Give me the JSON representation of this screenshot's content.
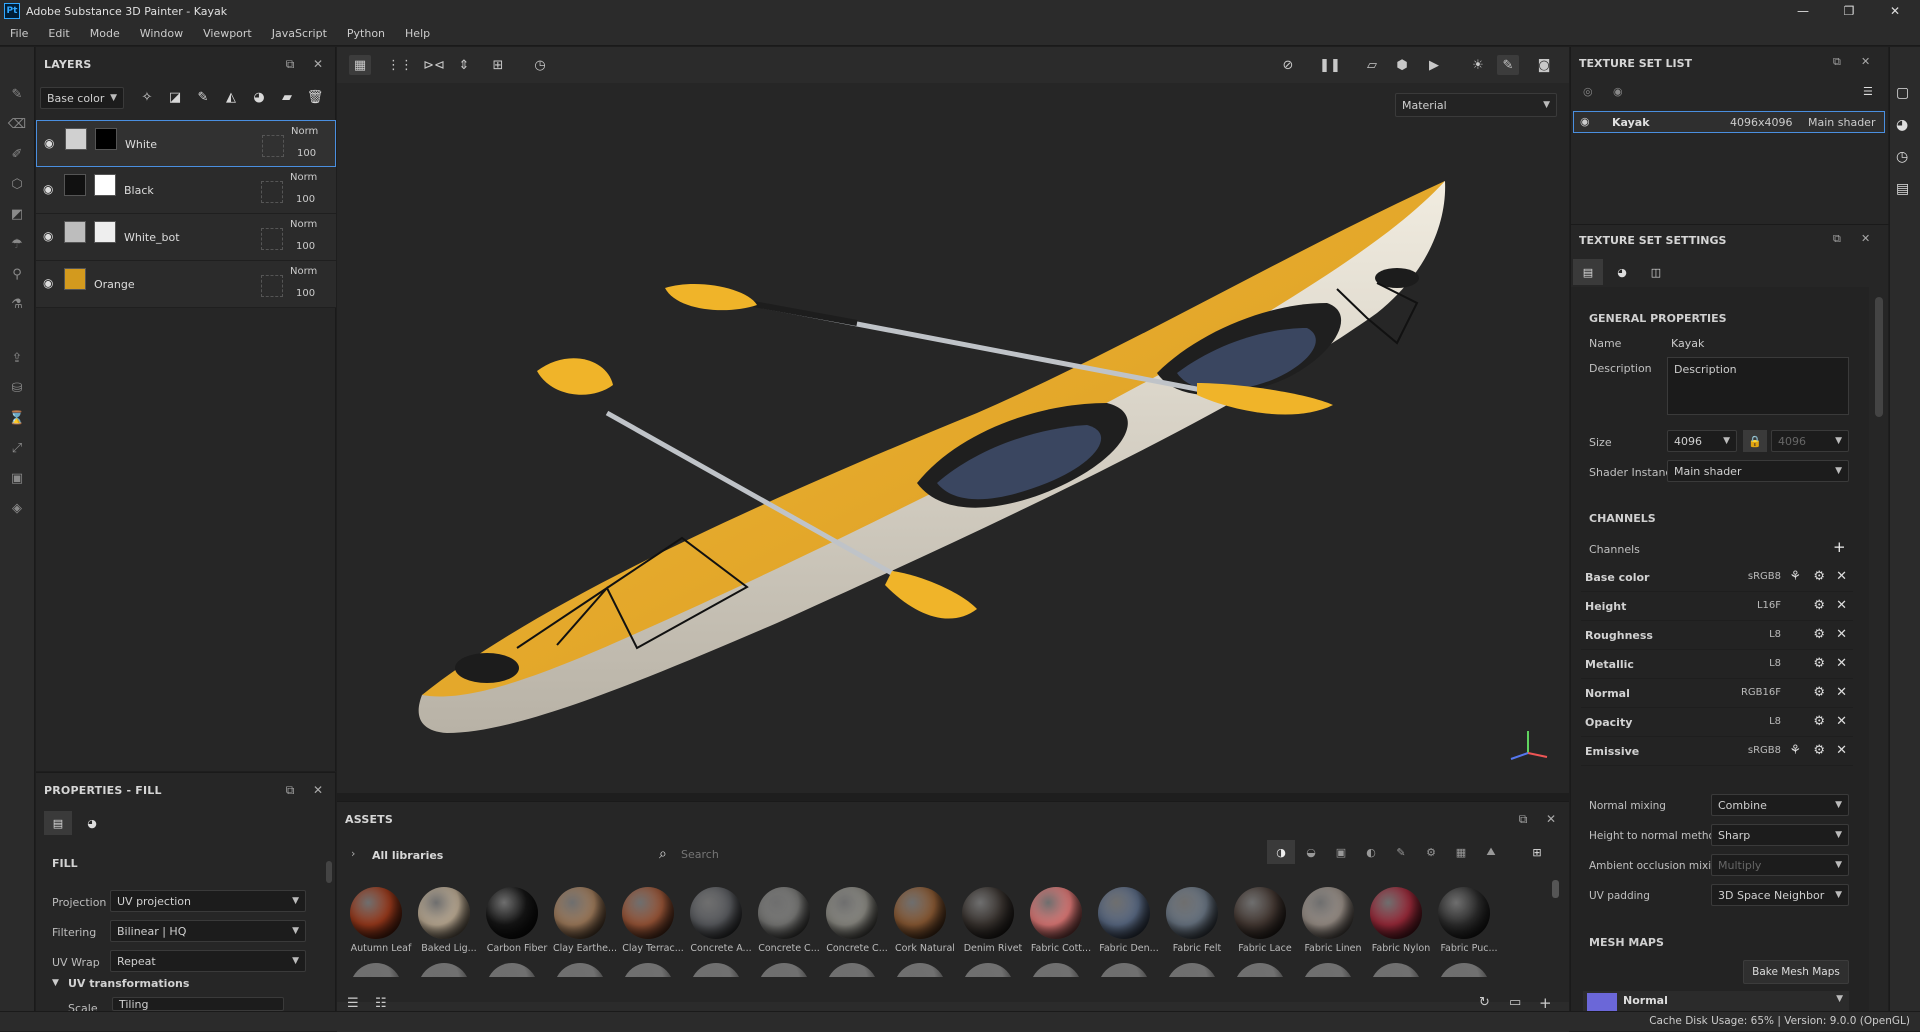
{
  "app": {
    "title": "Adobe Substance 3D Painter - Kayak",
    "logo": "Pt",
    "minimize": "—",
    "maximize": "❐",
    "close": "✕"
  },
  "menu": [
    "File",
    "Edit",
    "Mode",
    "Window",
    "Viewport",
    "JavaScript",
    "Python",
    "Help"
  ],
  "layers": {
    "title": "LAYERS",
    "channel_select": "Base color",
    "items": [
      {
        "name": "White",
        "blend": "Norm",
        "opacity": "100",
        "thumb": "#d0d0d0"
      },
      {
        "name": "Black",
        "blend": "Norm",
        "opacity": "100",
        "thumb": "#111111"
      },
      {
        "name": "White_bot",
        "blend": "Norm",
        "opacity": "100",
        "thumb": "#bdbdbd"
      },
      {
        "name": "Orange",
        "blend": "Norm",
        "opacity": "100",
        "thumb": "#d39a1e"
      }
    ]
  },
  "properties": {
    "title": "PROPERTIES - FILL",
    "section": "FILL",
    "projection_label": "Projection",
    "projection_value": "UV projection",
    "filtering_label": "Filtering",
    "filtering_value": "Bilinear | HQ",
    "uvwrap_label": "UV Wrap",
    "uvwrap_value": "Repeat",
    "uvtrans_label": "UV transformations",
    "scale_label": "Scale",
    "scale_value": "Tiling"
  },
  "viewport": {
    "material_mode": "Material"
  },
  "assets": {
    "title": "ASSETS",
    "library": "All libraries",
    "search_placeholder": "Search",
    "materials": [
      {
        "name": "Autumn Leaf",
        "color": "#9a3a1c"
      },
      {
        "name": "Baked Lig...",
        "color": "#bfae96"
      },
      {
        "name": "Carbon Fiber",
        "color": "#161616"
      },
      {
        "name": "Clay Earthe...",
        "color": "#a07c5c"
      },
      {
        "name": "Clay Terrac...",
        "color": "#9a5638"
      },
      {
        "name": "Concrete A...",
        "color": "#5a5c60"
      },
      {
        "name": "Concrete C...",
        "color": "#7a7a78"
      },
      {
        "name": "Concrete C...",
        "color": "#8c8b84"
      },
      {
        "name": "Cork Natural",
        "color": "#8a5a34"
      },
      {
        "name": "Denim Rivet",
        "color": "#3a3430"
      },
      {
        "name": "Fabric Cott...",
        "color": "#e07a78"
      },
      {
        "name": "Fabric Den...",
        "color": "#5a6a84"
      },
      {
        "name": "Fabric Felt",
        "color": "#6a7684"
      },
      {
        "name": "Fabric Lace",
        "color": "#463a34"
      },
      {
        "name": "Fabric Linen",
        "color": "#9a9088"
      },
      {
        "name": "Fabric Nylon",
        "color": "#9a2a3a"
      },
      {
        "name": "Fabric Puc...",
        "color": "#2e2e2e"
      }
    ]
  },
  "texture_set_list": {
    "title": "TEXTURE SET LIST",
    "item_name": "Kayak",
    "item_size": "4096x4096",
    "item_shader": "Main shader"
  },
  "texture_set_settings": {
    "title": "TEXTURE SET SETTINGS",
    "general": "GENERAL PROPERTIES",
    "name_label": "Name",
    "name_value": "Kayak",
    "description_label": "Description",
    "description_value": "Description",
    "size_label": "Size",
    "size_value": "4096",
    "size_value2": "4096",
    "shader_label": "Shader Instance",
    "shader_value": "Main shader",
    "channels_title": "CHANNELS",
    "channels_label": "Channels",
    "channels": [
      {
        "name": "Base color",
        "format": "sRGB8"
      },
      {
        "name": "Height",
        "format": "L16F"
      },
      {
        "name": "Roughness",
        "format": "L8"
      },
      {
        "name": "Metallic",
        "format": "L8"
      },
      {
        "name": "Normal",
        "format": "RGB16F"
      },
      {
        "name": "Opacity",
        "format": "L8"
      },
      {
        "name": "Emissive",
        "format": "sRGB8"
      }
    ],
    "normal_mixing_label": "Normal mixing",
    "normal_mixing_value": "Combine",
    "h2n_label": "Height to normal method",
    "h2n_value": "Sharp",
    "ao_label": "Ambient occlusion mixing",
    "ao_value": "Multiply",
    "uvpad_label": "UV padding",
    "uvpad_value": "3D Space Neighbor",
    "mesh_maps_title": "MESH MAPS",
    "bake_button": "Bake Mesh Maps",
    "mesh_map_item": "Normal"
  },
  "status": {
    "text": "Cache Disk Usage:   65% | Version: 9.0.0 (OpenGL)"
  },
  "colors": {
    "accent": "#4a8fe0",
    "kayak_yellow": "#f0b429",
    "kayak_hull": "#e8e2d4"
  }
}
